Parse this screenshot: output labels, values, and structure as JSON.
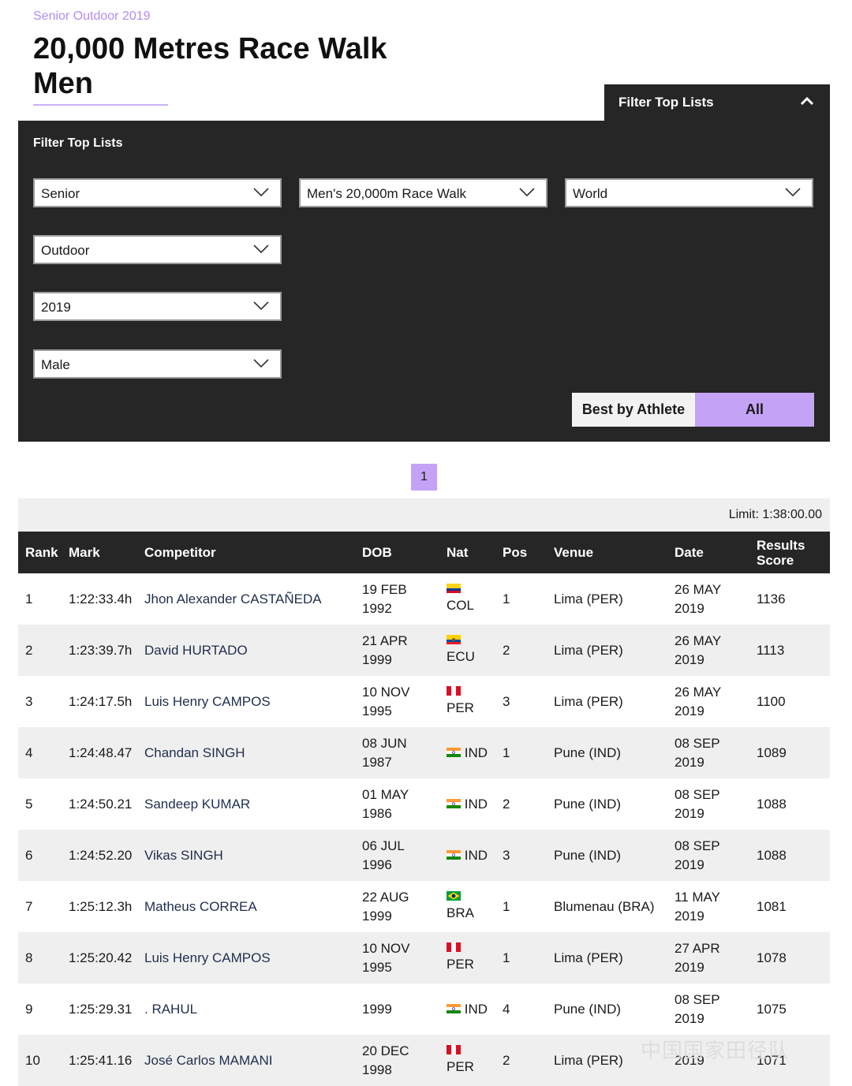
{
  "page": {
    "eyebrow": "Senior Outdoor 2019",
    "title_line1": "20,000 Metres Race Walk",
    "title_line2": "Men"
  },
  "filter": {
    "tab_label": "Filter Top Lists",
    "panel_title": "Filter Top Lists",
    "age": "Senior",
    "discipline": "Men's 20,000m Race Walk",
    "region": "World",
    "environment": "Outdoor",
    "year": "2019",
    "gender": "Male",
    "best_by_athlete": "Best by Athlete",
    "all": "All"
  },
  "pagination": {
    "current": "1"
  },
  "limit": "Limit: 1:38:00.00",
  "columns": {
    "rank": "Rank",
    "mark": "Mark",
    "competitor": "Competitor",
    "dob": "DOB",
    "nat": "Nat",
    "pos": "Pos",
    "venue": "Venue",
    "date": "Date",
    "score_l1": "Results",
    "score_l2": "Score"
  },
  "rows": [
    {
      "rank": "1",
      "mark": "1:22:33.4h",
      "competitor": "Jhon Alexander CASTAÑEDA",
      "dob1": "19 FEB",
      "dob2": "1992",
      "nat": "COL",
      "pos": "1",
      "venue": "Lima (PER)",
      "date1": "26 MAY",
      "date2": "2019",
      "score": "1136"
    },
    {
      "rank": "2",
      "mark": "1:23:39.7h",
      "competitor": "David HURTADO",
      "dob1": "21 APR",
      "dob2": "1999",
      "nat": "ECU",
      "pos": "2",
      "venue": "Lima (PER)",
      "date1": "26 MAY",
      "date2": "2019",
      "score": "1113"
    },
    {
      "rank": "3",
      "mark": "1:24:17.5h",
      "competitor": "Luis Henry CAMPOS",
      "dob1": "10 NOV",
      "dob2": "1995",
      "nat": "PER",
      "pos": "3",
      "venue": "Lima (PER)",
      "date1": "26 MAY",
      "date2": "2019",
      "score": "1100"
    },
    {
      "rank": "4",
      "mark": "1:24:48.47",
      "competitor": "Chandan SINGH",
      "dob1": "08 JUN",
      "dob2": "1987",
      "nat": "IND",
      "pos": "1",
      "venue": "Pune (IND)",
      "date1": "08 SEP",
      "date2": "2019",
      "score": "1089"
    },
    {
      "rank": "5",
      "mark": "1:24:50.21",
      "competitor": "Sandeep KUMAR",
      "dob1": "01 MAY",
      "dob2": "1986",
      "nat": "IND",
      "pos": "2",
      "venue": "Pune (IND)",
      "date1": "08 SEP",
      "date2": "2019",
      "score": "1088"
    },
    {
      "rank": "6",
      "mark": "1:24:52.20",
      "competitor": "Vikas SINGH",
      "dob1": "06 JUL",
      "dob2": "1996",
      "nat": "IND",
      "pos": "3",
      "venue": "Pune (IND)",
      "date1": "08 SEP",
      "date2": "2019",
      "score": "1088"
    },
    {
      "rank": "7",
      "mark": "1:25:12.3h",
      "competitor": "Matheus CORREA",
      "dob1": "22 AUG",
      "dob2": "1999",
      "nat": "BRA",
      "pos": "1",
      "venue": "Blumenau (BRA)",
      "date1": "11 MAY",
      "date2": "2019",
      "score": "1081"
    },
    {
      "rank": "8",
      "mark": "1:25:20.42",
      "competitor": "Luis Henry CAMPOS",
      "dob1": "10 NOV",
      "dob2": "1995",
      "nat": "PER",
      "pos": "1",
      "venue": "Lima (PER)",
      "date1": "27 APR",
      "date2": "2019",
      "score": "1078"
    },
    {
      "rank": "9",
      "mark": "1:25:29.31",
      "competitor": ". RAHUL",
      "dob1": "",
      "dob2": "1999",
      "nat": "IND",
      "pos": "4",
      "venue": "Pune (IND)",
      "date1": "08 SEP",
      "date2": "2019",
      "score": "1075"
    },
    {
      "rank": "10",
      "mark": "1:25:41.16",
      "competitor": "José Carlos MAMANI",
      "dob1": "20 DEC",
      "dob2": "1998",
      "nat": "PER",
      "pos": "2",
      "venue": "Lima (PER)",
      "date1": "",
      "date2": "2019",
      "score": "1071"
    }
  ],
  "watermark": "中国国家田径队"
}
